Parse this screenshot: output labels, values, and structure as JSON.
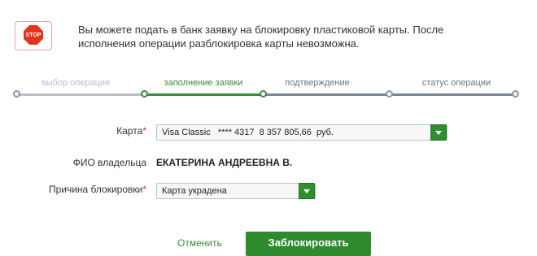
{
  "notice": {
    "icon": "stop-icon",
    "icon_text": "STOP",
    "line1": "Вы можете подать в банк заявку на блокировку пластиковой карты. После",
    "line2": "исполнения операции разблокировка карты невозможна."
  },
  "steps": [
    {
      "label": "выбор операции",
      "state": "done"
    },
    {
      "label": "заполнение заявки",
      "state": "active"
    },
    {
      "label": "подтверждение",
      "state": "pending"
    },
    {
      "label": "статус операции",
      "state": "pending"
    }
  ],
  "form": {
    "card_label": "Карта",
    "card_value": "Visa Classic   **** 4317  8 357 805,66  руб.",
    "owner_label": "ФИО владельца",
    "owner_value": "ЕКАТЕРИНА АНДРЕЕВНА В.",
    "reason_label": "Причина блокировки",
    "reason_value": "Карта украдена",
    "required_mark": "*"
  },
  "actions": {
    "cancel_label": "Отменить",
    "submit_label": "Заблокировать"
  },
  "colors": {
    "accent_green": "#2e8b2e",
    "required_red": "#e2341d",
    "pending_gray": "#8a96a6"
  }
}
